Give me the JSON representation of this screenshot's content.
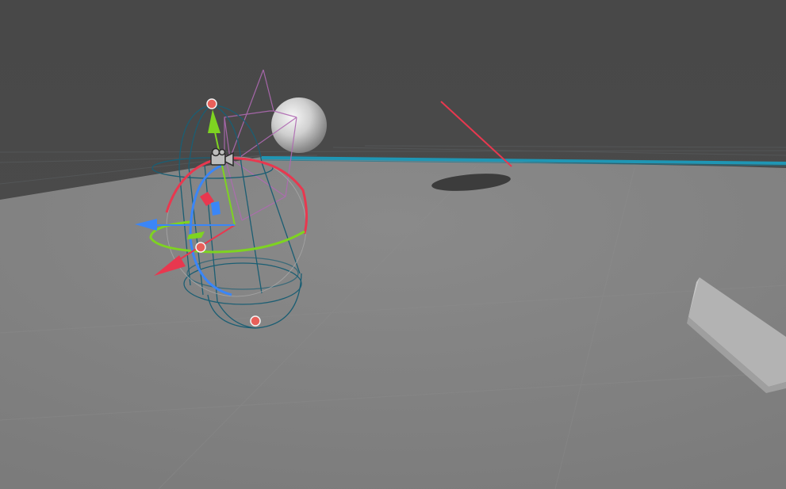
{
  "window": {
    "title": "",
    "view": "scene-view"
  },
  "colors": {
    "sky": "#464646",
    "ground": "#838383",
    "grid_line": "#5c6a70",
    "horizon_blue": "#1f96b4",
    "axis_x": "#e8384f",
    "axis_y": "#7ed321",
    "axis_z": "#3b86f7",
    "collider_wire": "#1b5e73",
    "camera_frustum": "#b06ab3",
    "selection_dot": "#e8605a"
  },
  "scene": {
    "objects": [
      {
        "name": "sphere",
        "type": "mesh"
      },
      {
        "name": "capsule-collider",
        "type": "collider"
      },
      {
        "name": "camera",
        "type": "camera"
      },
      {
        "name": "floor-plane",
        "type": "mesh"
      },
      {
        "name": "block",
        "type": "mesh"
      }
    ],
    "selected_object": "capsule-collider",
    "active_tool": "rotate"
  },
  "gizmo": {
    "axes": [
      "x",
      "y",
      "z"
    ],
    "handle_icon": "camera-icon"
  }
}
